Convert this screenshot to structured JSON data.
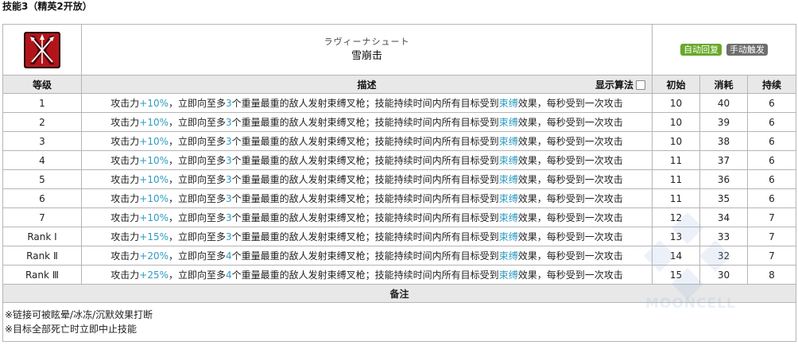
{
  "heading": "技能3（精英2开放）",
  "skill": {
    "name_jp": "ラヴィーナシュート",
    "name_cn": "雪崩击",
    "tags": [
      "自动回复",
      "手动触发"
    ]
  },
  "columns": {
    "level": "等级",
    "desc": "描述",
    "toggle_label": "显示算法",
    "initial": "初始",
    "cost": "消耗",
    "duration": "持续"
  },
  "desc_parts": {
    "p1": "攻击力",
    "p3": "，立即向至多",
    "p5": "个重量最重的敌人发射束缚叉枪；技能持续时间内所有目标受到",
    "bind": "束缚",
    "p6": "效果，每秒受到一次攻击"
  },
  "rows": [
    {
      "level": "1",
      "atk": "+10%",
      "count": "3",
      "initial": "10",
      "cost": "40",
      "duration": "6"
    },
    {
      "level": "2",
      "atk": "+10%",
      "count": "3",
      "initial": "10",
      "cost": "39",
      "duration": "6"
    },
    {
      "level": "3",
      "atk": "+10%",
      "count": "3",
      "initial": "10",
      "cost": "38",
      "duration": "6"
    },
    {
      "level": "4",
      "atk": "+10%",
      "count": "3",
      "initial": "11",
      "cost": "37",
      "duration": "6"
    },
    {
      "level": "5",
      "atk": "+10%",
      "count": "3",
      "initial": "11",
      "cost": "36",
      "duration": "6"
    },
    {
      "level": "6",
      "atk": "+10%",
      "count": "3",
      "initial": "11",
      "cost": "35",
      "duration": "6"
    },
    {
      "level": "7",
      "atk": "+10%",
      "count": "3",
      "initial": "12",
      "cost": "34",
      "duration": "7"
    },
    {
      "level": "Rank Ⅰ",
      "atk": "+15%",
      "count": "3",
      "initial": "13",
      "cost": "33",
      "duration": "7"
    },
    {
      "level": "Rank Ⅱ",
      "atk": "+20%",
      "count": "4",
      "initial": "14",
      "cost": "32",
      "duration": "7"
    },
    {
      "level": "Rank Ⅲ",
      "atk": "+25%",
      "count": "4",
      "initial": "15",
      "cost": "30",
      "duration": "8"
    }
  ],
  "notes_title": "备注",
  "notes": [
    "※链接可被眩晕/冰冻/沉默效果打断",
    "※目标全部死亡时立即中止技能"
  ],
  "watermark": "MOONCELL",
  "colors": {
    "accent_blue": "#2f9bc0",
    "tag_green": "#6aa82a",
    "tag_gray": "#6e6e6e",
    "header_bg": "#e8e8e8",
    "icon_red": "#c0161c"
  }
}
